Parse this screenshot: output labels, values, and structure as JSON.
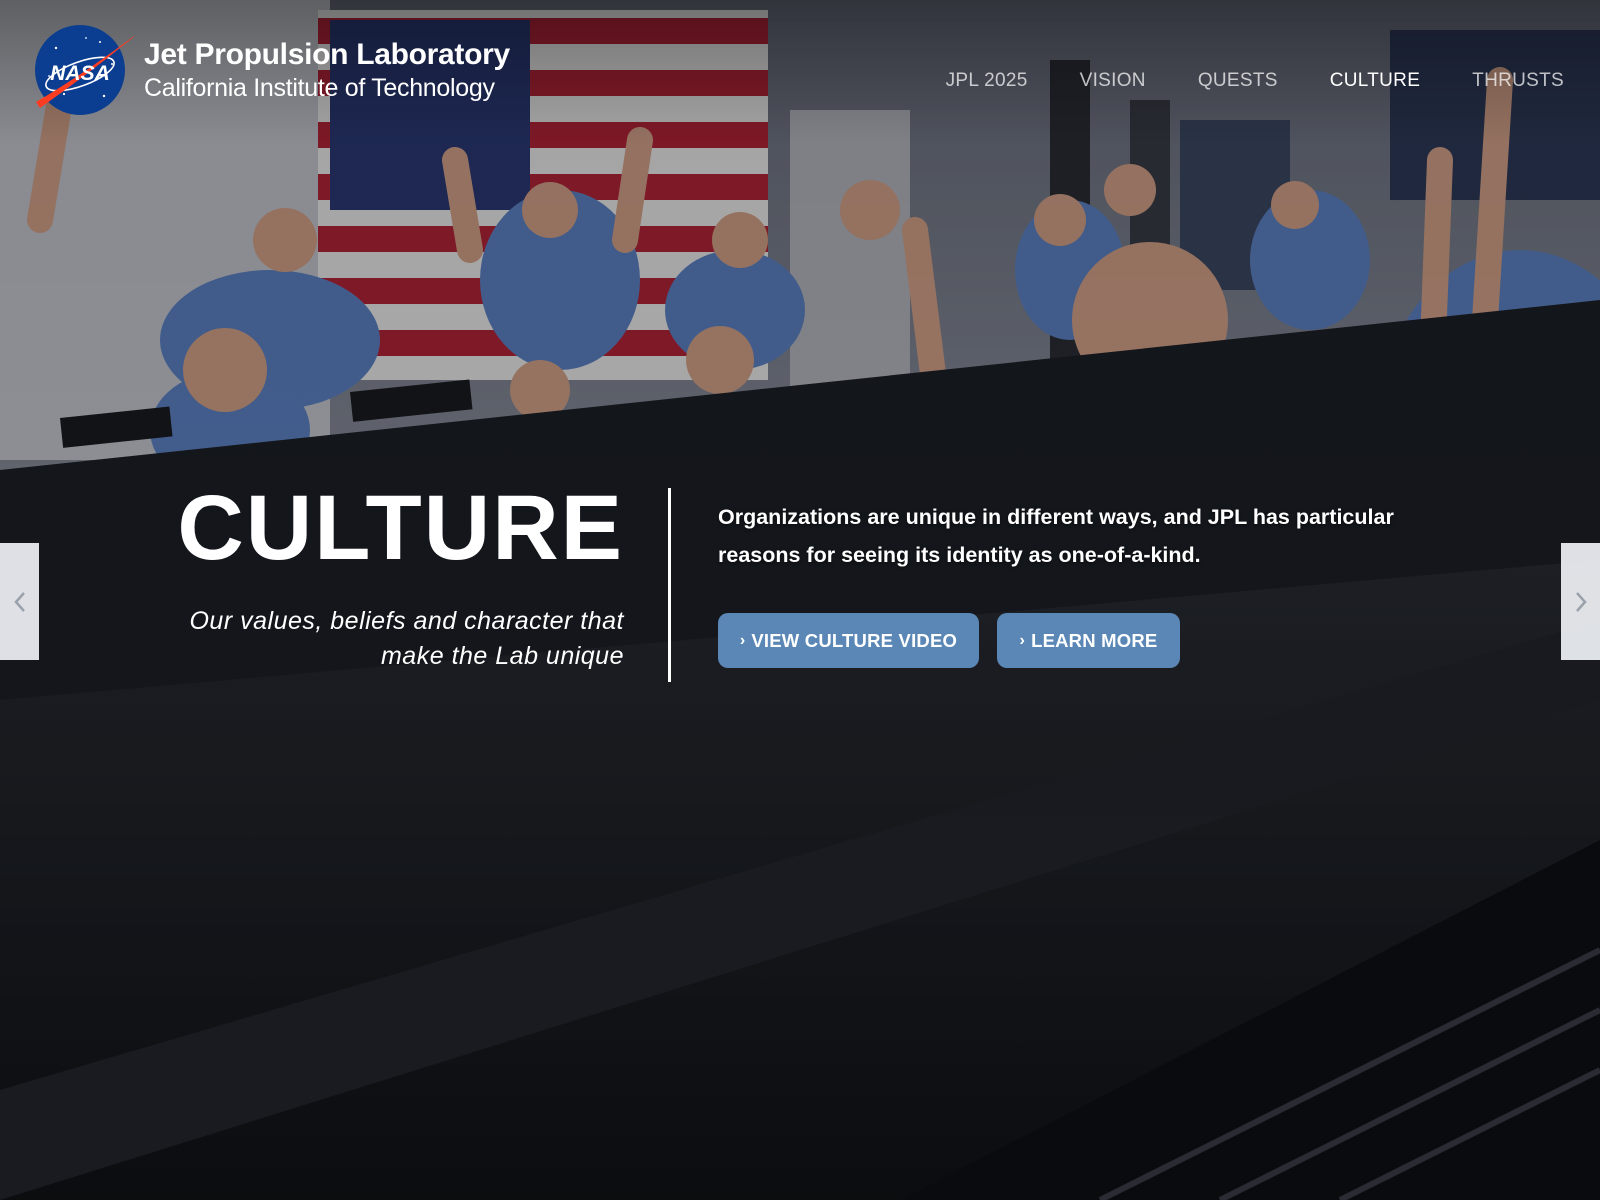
{
  "header": {
    "org_title": "Jet Propulsion Laboratory",
    "org_subtitle": "California Institute of Technology",
    "logo_text": "NASA"
  },
  "nav": {
    "items": [
      {
        "label": "JPL 2025",
        "active": false
      },
      {
        "label": "VISION",
        "active": false
      },
      {
        "label": "QUESTS",
        "active": false
      },
      {
        "label": "CULTURE",
        "active": true
      },
      {
        "label": "THRUSTS",
        "active": false
      }
    ]
  },
  "hero": {
    "title": "CULTURE",
    "tagline": "Our values, beliefs and character that make the Lab unique",
    "description": "Organizations are unique in different ways, and JPL has particular reasons for seeing its identity as one-of-a-kind.",
    "buttons": {
      "video_label": "VIEW CULTURE VIDEO",
      "learn_label": "LEARN MORE"
    }
  },
  "carousel": {
    "prev_icon": "chevron-left-icon",
    "next_icon": "chevron-right-icon"
  },
  "colors": {
    "button_blue": "#5a87b5",
    "nasa_blue": "#0b3d91",
    "nasa_red": "#fc3d21"
  }
}
